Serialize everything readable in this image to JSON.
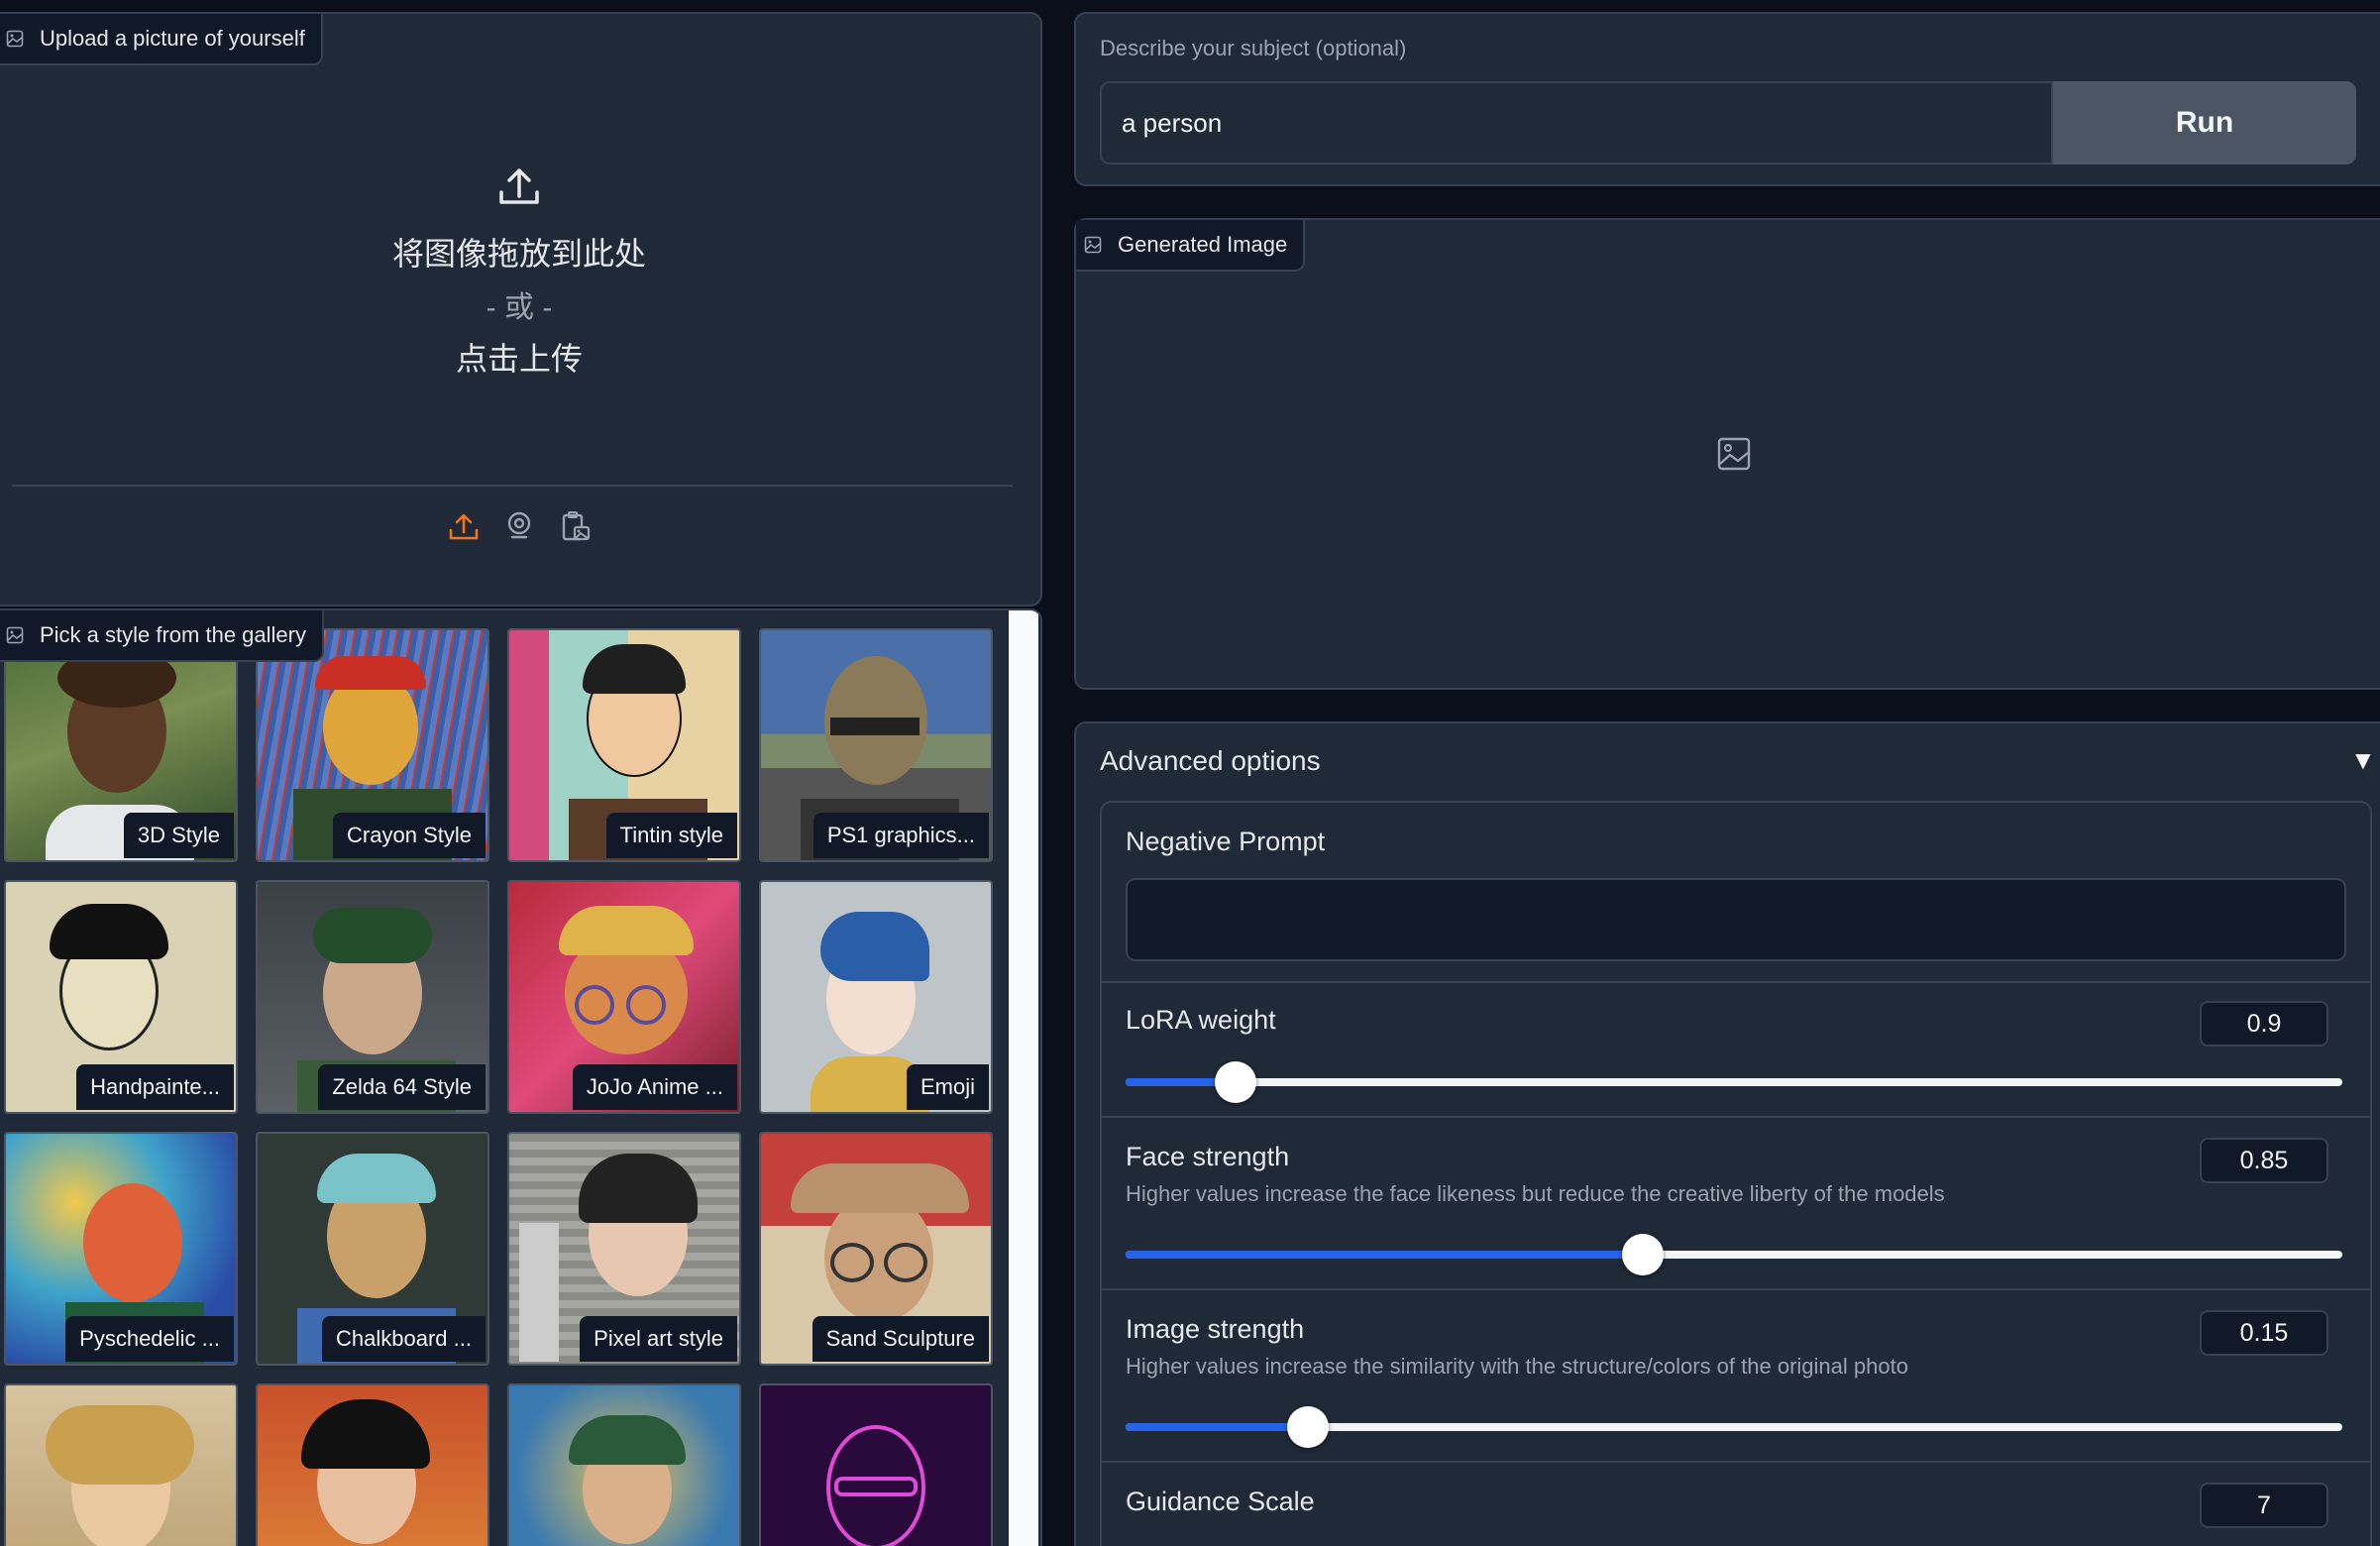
{
  "upload": {
    "label": "Upload a picture of yourself",
    "drop_text": "将图像拖放到此处",
    "or_text": "- 或 -",
    "click_text": "点击上传"
  },
  "gallery": {
    "label": "Pick a style from the gallery",
    "items": [
      {
        "caption": "3D Style"
      },
      {
        "caption": "Crayon Style"
      },
      {
        "caption": "Tintin style"
      },
      {
        "caption": "PS1 graphics..."
      },
      {
        "caption": "Handpainte..."
      },
      {
        "caption": "Zelda 64 Style"
      },
      {
        "caption": "JoJo Anime ..."
      },
      {
        "caption": "Emoji"
      },
      {
        "caption": "Pyschedelic ..."
      },
      {
        "caption": "Chalkboard ..."
      },
      {
        "caption": "Pixel art style"
      },
      {
        "caption": "Sand Sculpture"
      }
    ]
  },
  "subject": {
    "label": "Describe your subject (optional)",
    "value": "a person",
    "run_label": "Run"
  },
  "output": {
    "label": "Generated Image"
  },
  "advanced": {
    "title": "Advanced options",
    "toggle": "▼",
    "negative_prompt": {
      "title": "Negative Prompt",
      "value": ""
    },
    "lora_weight": {
      "title": "LoRA weight",
      "value": "0.9",
      "fraction": 0.09
    },
    "face_strength": {
      "title": "Face strength",
      "info": "Higher values increase the face likeness but reduce the creative liberty of the models",
      "value": "0.85",
      "fraction": 0.425
    },
    "image_strength": {
      "title": "Image strength",
      "info": "Higher values increase the similarity with the structure/colors of the original photo",
      "value": "0.15",
      "fraction": 0.15
    },
    "guidance_scale": {
      "title": "Guidance Scale",
      "value": "7"
    }
  }
}
